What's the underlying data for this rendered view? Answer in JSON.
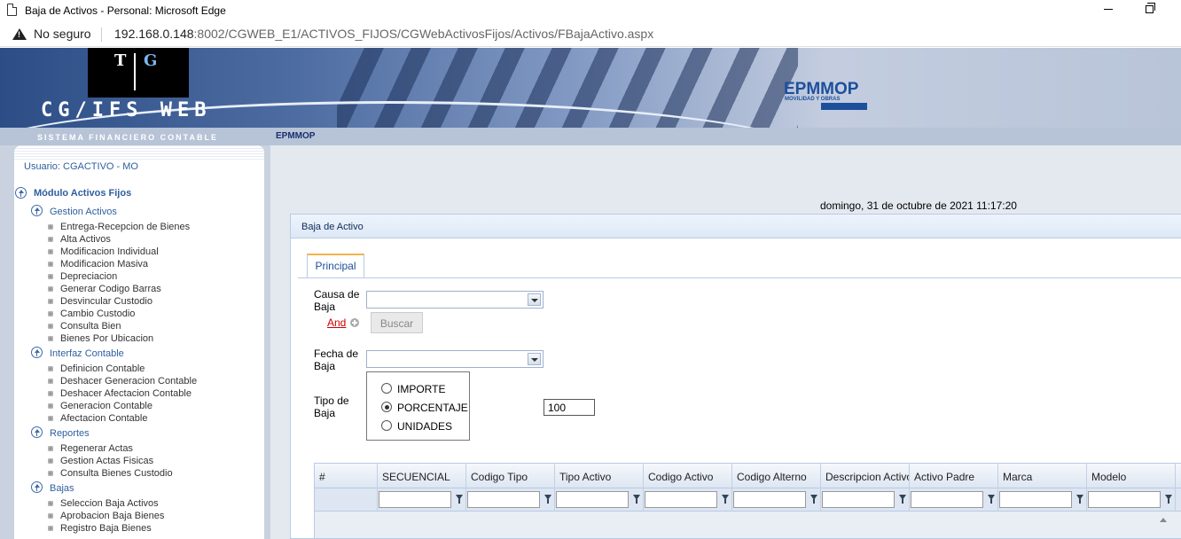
{
  "window": {
    "title": "Baja de Activos - Personal: Microsoft Edge"
  },
  "address": {
    "security": "No seguro",
    "host": "192.168.0.148",
    "path": ":8002/CGWEB_E1/ACTIVOS_FIJOS/CGWebActivosFijos/Activos/FBajaActivo.aspx"
  },
  "banner": {
    "logo_t": "T",
    "logo_g": "G",
    "app_name": "CG/IFS WEB",
    "tagline": "SISTEMA FINANCIERO CONTABLE",
    "brand": "EPMMOP",
    "brand_sub": "MOVILIDAD Y OBRAS",
    "org_label": "EPMMOP"
  },
  "sidebar": {
    "user": "Usuario: CGACTIVO - MO",
    "module": "Módulo Activos Fijos",
    "groups": [
      {
        "title": "Gestion Activos",
        "items": [
          "Entrega-Recepcion de Bienes",
          "Alta Activos",
          "Modificacion Individual",
          "Modificacion Masiva",
          "Depreciacion",
          "Generar Codigo Barras",
          "Desvincular Custodio",
          "Cambio Custodio",
          "Consulta Bien",
          "Bienes Por Ubicacion"
        ]
      },
      {
        "title": "Interfaz Contable",
        "items": [
          "Definicion Contable",
          "Deshacer Generacion Contable",
          "Deshacer Afectacion Contable",
          "Generacion Contable",
          "Afectacion Contable"
        ]
      },
      {
        "title": "Reportes",
        "items": [
          "Regenerar Actas",
          "Gestion Actas Fisicas",
          "Consulta Bienes Custodio"
        ]
      },
      {
        "title": "Bajas",
        "items": [
          "Seleccion Baja Activos",
          "Aprobacion Baja Bienes",
          "Registro Baja Bienes"
        ]
      }
    ]
  },
  "main": {
    "datetime": "domingo, 31 de octubre de 2021 11:17:20",
    "panel_title": "Baja de Activo",
    "tab": "Principal",
    "causa_label_1": "Causa de",
    "causa_label_2": "Baja",
    "and_link": "And",
    "buscar": "Buscar",
    "fecha_label_1": "Fecha de",
    "fecha_label_2": "Baja",
    "tipo_label_1": "Tipo de",
    "tipo_label_2": "Baja",
    "radios": [
      "IMPORTE",
      "PORCENTAJE",
      "UNIDADES"
    ],
    "selected_radio": "PORCENTAJE",
    "value": "100"
  },
  "grid": {
    "columns": [
      "#",
      "SECUENCIAL",
      "Codigo Tipo",
      "Tipo Activo",
      "Codigo Activo",
      "Codigo Alterno",
      "Descripcion Activo",
      "Activo Padre",
      "Marca",
      "Modelo"
    ]
  }
}
